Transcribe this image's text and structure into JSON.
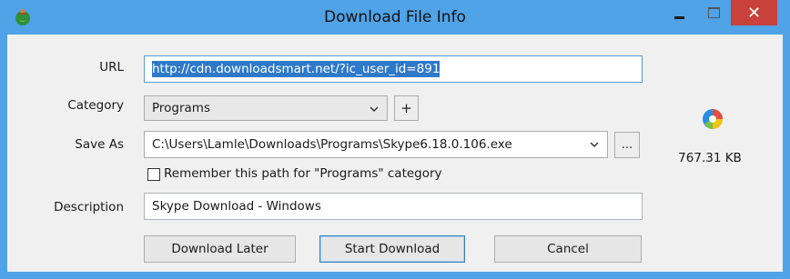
{
  "window": {
    "title": "Download File Info",
    "close_glyph": "✕"
  },
  "form": {
    "url_label": "URL",
    "url_value": "http://cdn.downloadsmart.net/?ic_user_id=891",
    "category_label": "Category",
    "category_value": "Programs",
    "add_category_label": "+",
    "save_as_label": "Save As",
    "save_as_value": "C:\\Users\\Lamle\\Downloads\\Programs\\Skype6.18.0.106.exe",
    "browse_label": "...",
    "remember_label": "Remember this path for \"Programs\" category",
    "remember_checked": false,
    "description_label": "Description",
    "description_value": "Skype Download - Windows"
  },
  "file": {
    "icon": "skype-file-icon",
    "size": "767.31  KB"
  },
  "buttons": {
    "download_later": "Download Later",
    "start_download": "Start Download",
    "cancel": "Cancel"
  },
  "colors": {
    "titlebar": "#4fa3e6",
    "close": "#c8413a",
    "selection": "#2e79c9"
  }
}
